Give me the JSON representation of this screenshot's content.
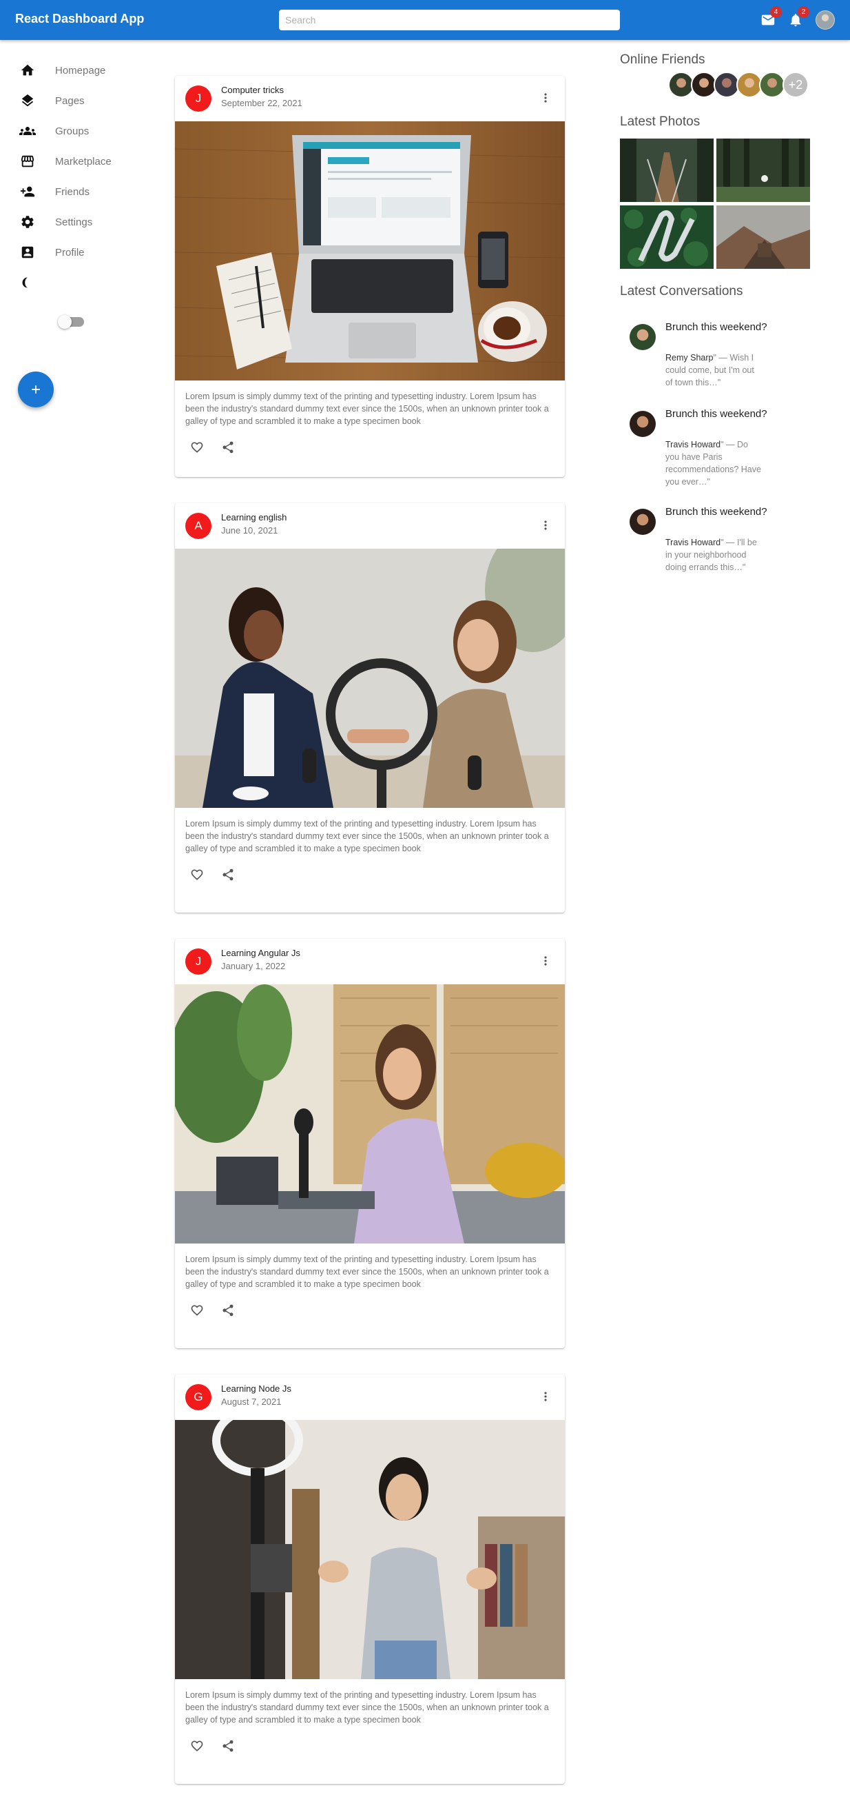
{
  "app": {
    "title": "React Dashboard App"
  },
  "search": {
    "placeholder": "Search"
  },
  "notifications": {
    "mail_count": "4",
    "bell_count": "2"
  },
  "sidebar": {
    "items": [
      {
        "label": "Homepage",
        "icon": "home-icon"
      },
      {
        "label": "Pages",
        "icon": "layers-icon"
      },
      {
        "label": "Groups",
        "icon": "groups-icon"
      },
      {
        "label": "Marketplace",
        "icon": "storefront-icon"
      },
      {
        "label": "Friends",
        "icon": "person-add-icon"
      },
      {
        "label": "Settings",
        "icon": "gear-icon"
      },
      {
        "label": "Profile",
        "icon": "account-box-icon"
      }
    ],
    "dark_mode_icon": "moon-icon",
    "dark_mode_on": false
  },
  "fab": {
    "icon": "add-icon",
    "label": "+"
  },
  "posts": [
    {
      "avatar_letter": "J",
      "title": "Computer tricks",
      "date": "September 22, 2021",
      "text": "Lorem Ipsum is simply dummy text of the printing and typesetting industry. Lorem Ipsum has been the industry's standard dummy text ever since the 1500s, when an unknown printer took a galley of type and scrambled it to make a type specimen book"
    },
    {
      "avatar_letter": "A",
      "title": "Learning english",
      "date": "June 10, 2021",
      "text": "Lorem Ipsum is simply dummy text of the printing and typesetting industry. Lorem Ipsum has been the industry's standard dummy text ever since the 1500s, when an unknown printer took a galley of type and scrambled it to make a type specimen book"
    },
    {
      "avatar_letter": "J",
      "title": "Learning Angular Js",
      "date": "January 1, 2022",
      "text": "Lorem Ipsum is simply dummy text of the printing and typesetting industry. Lorem Ipsum has been the industry's standard dummy text ever since the 1500s, when an unknown printer took a galley of type and scrambled it to make a type specimen book"
    },
    {
      "avatar_letter": "G",
      "title": "Learning Node Js",
      "date": "August 7, 2021",
      "text": "Lorem Ipsum is simply dummy text of the printing and typesetting industry. Lorem Ipsum has been the industry's standard dummy text ever since the 1500s, when an unknown printer took a galley of type and scrambled it to make a type specimen book"
    }
  ],
  "rightbar": {
    "online_friends_title": "Online Friends",
    "online_friends_more": "+2",
    "latest_photos_title": "Latest Photos",
    "latest_conversations_title": "Latest Conversations",
    "conversations": [
      {
        "subject": "Brunch this weekend?",
        "sender": "Remy Sharp",
        "preview": "\" — Wish I could come, but I'm out of town this…\""
      },
      {
        "subject": "Brunch this weekend?",
        "sender": "Travis Howard",
        "preview": "\" — Do you have Paris recommendations? Have you ever…\""
      },
      {
        "subject": "Brunch this weekend?",
        "sender": "Travis Howard",
        "preview": "\" — I'll be in your neighborhood doing errands this…\""
      }
    ]
  },
  "colors": {
    "appbar": "#1976d2",
    "avatar_red": "#f21b1b",
    "badge": "#d32f2f"
  }
}
